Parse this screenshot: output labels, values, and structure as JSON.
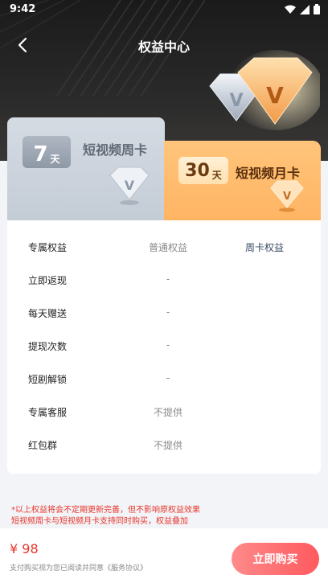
{
  "status_bar": {
    "time": "9:42"
  },
  "nav": {
    "title": "权益中心"
  },
  "cards": {
    "week": {
      "days": "7",
      "unit": "天",
      "name": "短视频周卡"
    },
    "month": {
      "days": "30",
      "unit": "天",
      "name": "短视频月卡"
    }
  },
  "table": {
    "header": {
      "col1": "专属权益",
      "col2": "普通权益",
      "col3": "周卡权益"
    },
    "rows": [
      {
        "label": "立即返现",
        "normal": "-",
        "card": ""
      },
      {
        "label": "每天赠送",
        "normal": "-",
        "card": ""
      },
      {
        "label": "提现次数",
        "normal": "-",
        "card": ""
      },
      {
        "label": "短剧解锁",
        "normal": "-",
        "card": ""
      },
      {
        "label": "专属客服",
        "normal": "不提供",
        "card": ""
      },
      {
        "label": "红包群",
        "normal": "不提供",
        "card": ""
      }
    ]
  },
  "notes": {
    "line1": "*以上权益将会不定期更新完善，但不影响原权益效果",
    "line2": "短视频周卡与短视频月卡支持同时购买，权益叠加"
  },
  "purchase": {
    "price": "¥ 98",
    "agreement": "支付购买视为您已阅读并同意《服务协议》",
    "buy_label": "立即购买"
  },
  "colors": {
    "accent_red": "#e8352b",
    "gold": "#ffb463",
    "silver": "#c4ccd6"
  },
  "icons": [
    "back-icon",
    "wifi-icon",
    "signal-icon",
    "battery-icon",
    "diamond-icon"
  ]
}
